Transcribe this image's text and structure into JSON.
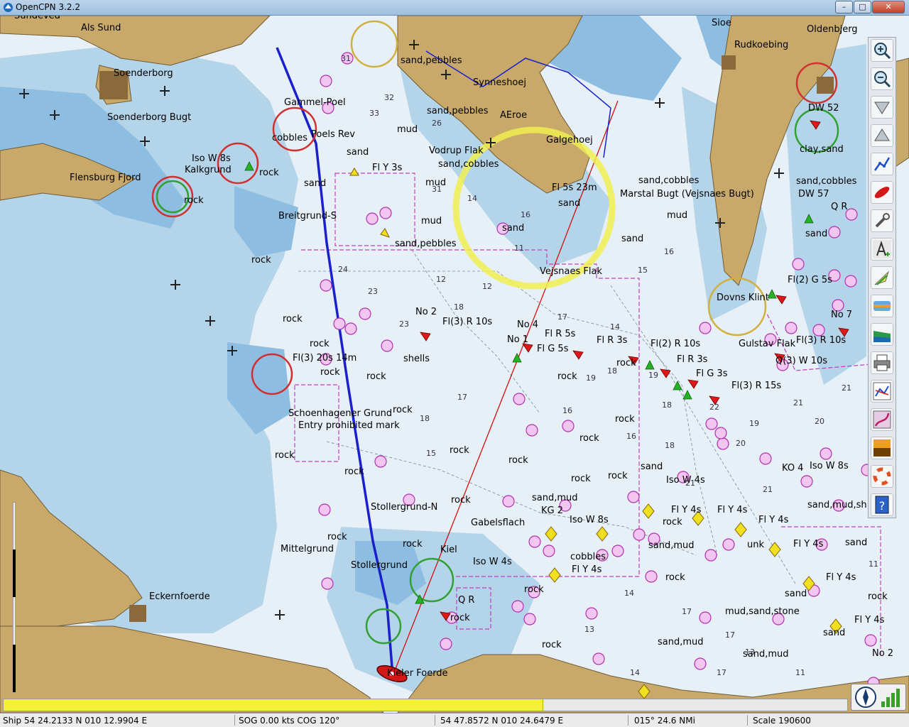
{
  "window": {
    "title": "OpenCPN 3.2.2",
    "minimize": "–",
    "maximize": "□",
    "close": "✕"
  },
  "chart": {
    "labels": {
      "sundeved": "Sundeved",
      "als_sund": "Als Sund",
      "soenderborg": "Soenderborg",
      "soenderborg_bugt": "Soenderborg Bugt",
      "gammel_poel": "Gammel-Poel",
      "poels_rev": "Poels Rev",
      "cobbles": "cobbles",
      "iso_w_8s": "Iso W 8s",
      "kalkgrund": "Kalkgrund",
      "flensburg_fjord": "Flensburg Fjord",
      "rock": "rock",
      "breitgrund": "Breitgrund-S",
      "sand": "sand",
      "mud": "mud",
      "sand_pebbles": "sand,pebbles",
      "sand_cobbles": "sand,cobbles",
      "fl_y_3s": "Fl Y 3s",
      "synneshoej": "Synneshoej",
      "aeroe": "AEroe",
      "vodrup_flak": "Vodrup Flak",
      "galgehoej": "Galgehoej",
      "fl_5s_23m": "Fl 5s 23m",
      "marstal_bugt": "Marstal Bugt (Vejsnaes Bugt)",
      "sioe": "Sioe",
      "rudkoebing": "Rudkoebing",
      "oldenbjerg": "Oldenbjerg",
      "vejsnaes_flak": "Vejsnaes Flak",
      "dovns_klint": "Dovns Klint",
      "fl2_g_5s": "Fl(2) G 5s",
      "dw_52": "DW 52",
      "dw_57": "DW 57",
      "clay_sand": "clay,sand",
      "q_r": "Q R",
      "no_2": "No 2",
      "fl3_r_10s": "Fl(3) R 10s",
      "no_4": "No 4",
      "no_1": "No 1",
      "fl_r_5s": "Fl R 5s",
      "fl_g_5s": "Fl G 5s",
      "fl_r_3s": "Fl R 3s",
      "fl2_r_10s": "Fl(2) R 10s",
      "fl_g_3s": "Fl G 3s",
      "fl3_r_15s": "Fl(3) R 15s",
      "gulstav_flak": "Gulstav Flak",
      "q3_w_10s": "Q(3) W 10s",
      "no_7": "No 7",
      "fl3_20s_14m": "Fl(3) 20s 14m",
      "shells": "shells",
      "schoenhagener": "Schoenhagener Grund",
      "entry_prohibited": "Entry prohibited mark",
      "stollergrund_n": "Stollergrund-N",
      "gabelsflach": "Gabelsflach",
      "mittelgrund": "Mittelgrund",
      "stollergrund": "Stollergrund",
      "kiel": "Kiel",
      "iso_w_4s": "Iso W 4s",
      "eckernfoerde": "Eckernfoerde",
      "kieler_foerde": "Kieler Foerde",
      "sand_mud": "sand,mud",
      "kg_2": "KG 2",
      "cobbles2": "cobbles",
      "fl_y_4s": "Fl Y 4s",
      "ko_4": "KO 4",
      "unk": "unk",
      "sand_mud_sh": "sand,mud,sh",
      "mud_sand_stone": "mud,sand,stone",
      "sand_mud2": "sand,mud"
    }
  },
  "toolbar": {
    "tools": [
      {
        "name": "zoom-in-tool",
        "icon": "zoom-in-icon"
      },
      {
        "name": "zoom-out-tool",
        "icon": "zoom-out-icon"
      },
      {
        "name": "scale-in-tool",
        "icon": "scale-in-icon"
      },
      {
        "name": "scale-out-tool",
        "icon": "scale-out-icon"
      },
      {
        "name": "route-tool",
        "icon": "route-icon"
      },
      {
        "name": "auto-follow-tool",
        "icon": "ship-icon"
      },
      {
        "name": "settings-tool",
        "icon": "wrench-icon"
      },
      {
        "name": "text-tool",
        "icon": "text-icon"
      },
      {
        "name": "current-tool",
        "icon": "current-icon"
      },
      {
        "name": "tide-tool",
        "icon": "tide-icon"
      },
      {
        "name": "layers-tool",
        "icon": "layers-icon"
      },
      {
        "name": "print-tool",
        "icon": "print-icon"
      },
      {
        "name": "route-manager-tool",
        "icon": "route-manager-icon"
      },
      {
        "name": "track-tool",
        "icon": "track-icon"
      },
      {
        "name": "color-scheme-tool",
        "icon": "sunset-icon"
      },
      {
        "name": "mob-tool",
        "icon": "lifebuoy-icon"
      },
      {
        "name": "help-tool",
        "icon": "help-icon"
      }
    ]
  },
  "progress": {
    "fill_percent": 64
  },
  "status": {
    "ship_pos": "Ship 54 24.2133 N   010 12.9904 E",
    "sog_cog": "SOG 0.00 kts   COG 120°",
    "cursor_pos": "54 47.8572 N   010 24.6479 E",
    "bearing_dist": "015°  24.6 NMi",
    "scale": "Scale 190600"
  },
  "colors": {
    "land": "#c9a96a",
    "shallow": "#9cc7e3",
    "deep": "#e7eff7",
    "route": "#1a20cc",
    "highlight": "#f6f46a"
  }
}
